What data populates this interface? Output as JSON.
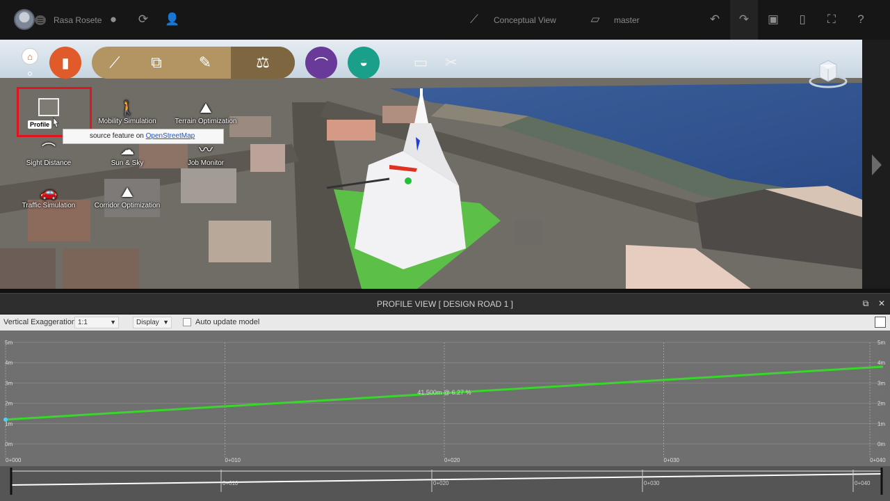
{
  "topbar": {
    "user_name": "Rasa Rosete",
    "view_mode": "Conceptual View",
    "branch": "master"
  },
  "toolbar_icons": {
    "circle_buttons": [
      {
        "name": "design-tool-icon",
        "color": "#e05a2a"
      },
      {
        "name": "bridge-tool-icon",
        "color": "#6a3a9a"
      },
      {
        "name": "water-tool-icon",
        "color": "#1aa08a"
      }
    ],
    "group_color": "#b39564",
    "group_active_color": "#7e6640"
  },
  "analysis_menu": {
    "items": [
      {
        "label": "Profile View",
        "short": "Profile"
      },
      {
        "label": "Mobility Simulation"
      },
      {
        "label": "Terrain Optimization"
      },
      {
        "label": "Sight Distance"
      },
      {
        "label": "Sun & Sky"
      },
      {
        "label": "Job Monitor"
      },
      {
        "label": "Traffic Simulation"
      },
      {
        "label": "Corridor Optimization"
      }
    ],
    "tooltip": {
      "text": "source feature on ",
      "link": "OpenStreetMap"
    }
  },
  "profile_panel": {
    "title": "PROFILE VIEW [ DESIGN ROAD 1 ]",
    "vertical_exaggeration_label": "Vertical Exaggeration",
    "vertical_exaggeration_value": "1:1",
    "display_label": "Display",
    "auto_update_label": "Auto update model",
    "auto_update_checked": false
  },
  "chart_data": {
    "type": "line",
    "y_ticks": [
      "5m",
      "4m",
      "3m",
      "2m",
      "1m",
      "0m"
    ],
    "x_ticks": [
      "0+000",
      "0+010",
      "0+020",
      "0+030",
      "0+040"
    ],
    "ylim": [
      0,
      5
    ],
    "xlim": [
      0,
      41.5
    ],
    "annotation": "41.500m @ 6.27 %",
    "series": [
      {
        "color": "#39d62b",
        "x": [
          0,
          41.5
        ],
        "y": [
          1.2,
          3.8
        ]
      }
    ],
    "overview_ticks": [
      "0+010",
      "0+020",
      "0+030",
      "0+040"
    ]
  }
}
